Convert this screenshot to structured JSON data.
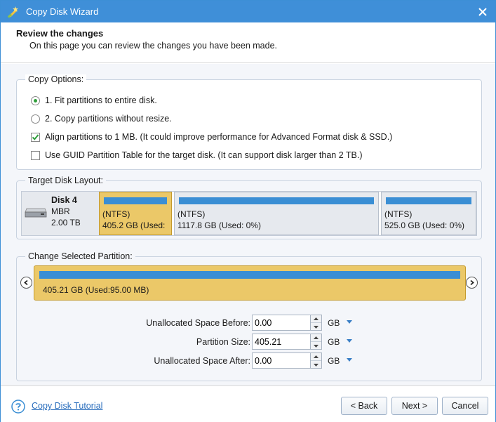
{
  "window": {
    "title": "Copy Disk Wizard",
    "title_icon": "wizard-wand-icon",
    "close_icon": "close-icon"
  },
  "header": {
    "title": "Review the changes",
    "subtitle": "On this page you can review the changes you have been made."
  },
  "copy_options": {
    "label": "Copy Options:",
    "radio_fit": {
      "label": "1. Fit partitions to entire disk.",
      "checked": true
    },
    "radio_copy": {
      "label": "2. Copy partitions without resize.",
      "checked": false
    },
    "check_align": {
      "label": "Align partitions to 1 MB.  (It could improve performance for Advanced Format disk & SSD.)",
      "checked": true
    },
    "check_gpt": {
      "label": "Use GUID Partition Table for the target disk. (It can support disk larger than 2 TB.)",
      "checked": false
    }
  },
  "target_layout": {
    "label": "Target Disk Layout:",
    "disk": {
      "name": "Disk 4",
      "type": "MBR",
      "size": "2.00 TB",
      "icon": "hard-disk-icon"
    },
    "partitions": [
      {
        "fs": "(NTFS)",
        "size": "405.2 GB (Used:",
        "selected": true
      },
      {
        "fs": "(NTFS)",
        "size": "1117.8 GB (Used: 0%)",
        "selected": false
      },
      {
        "fs": "(NTFS)",
        "size": "525.0 GB (Used: 0%)",
        "selected": false
      }
    ]
  },
  "change_partition": {
    "label": "Change Selected Partition:",
    "selected_text": "405.21 GB (Used:95.00 MB)",
    "fields": [
      {
        "label": "Unallocated Space Before:",
        "value": "0.00",
        "unit": "GB"
      },
      {
        "label": "Partition Size:",
        "value": "405.21",
        "unit": "GB"
      },
      {
        "label": "Unallocated Space After:",
        "value": "0.00",
        "unit": "GB"
      }
    ]
  },
  "footer": {
    "tutorial_link": "Copy Disk Tutorial",
    "back_label": "< Back",
    "next_label": "Next >",
    "cancel_label": "Cancel"
  },
  "colors": {
    "title_bar": "#3f8fd8",
    "partition_selected": "#ebc868",
    "partition_bar": "#3a8ed4",
    "link": "#2a6ebd"
  }
}
